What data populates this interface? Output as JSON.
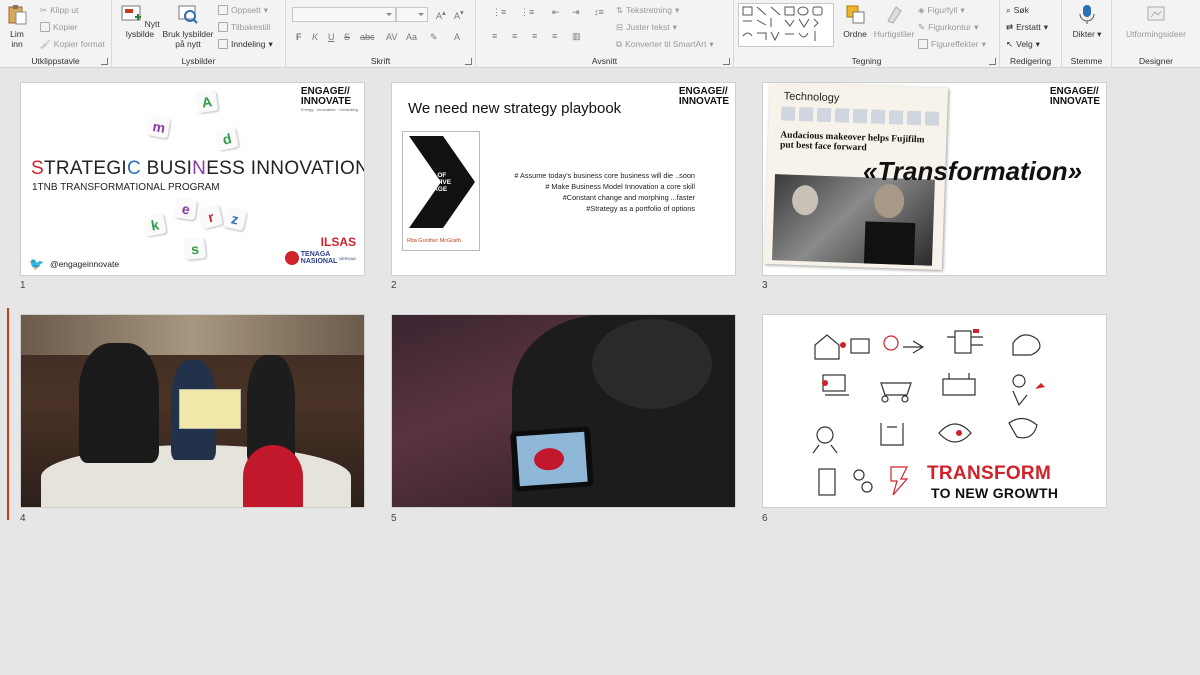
{
  "ribbon": {
    "clipboard": {
      "label": "Utklippstavle",
      "paste": "Lim\ninn",
      "cut": "Klipp ut",
      "copy": "Kopier",
      "format_painter": "Kopier format"
    },
    "slides": {
      "label": "Lysbilder",
      "new_slide": "Nytt\nlysbilde",
      "reuse": "Bruk lysbilder\npå nytt",
      "layout": "Oppsett",
      "reset": "Tilbakestill",
      "section": "Inndeling"
    },
    "font": {
      "label": "Skrift",
      "bold": "F",
      "italic": "K",
      "underline": "U",
      "strike": "S",
      "spacing": "AV",
      "case": "Aa"
    },
    "paragraph": {
      "label": "Avsnitt",
      "text_direction": "Tekstretning",
      "align_text": "Juster tekst",
      "smartart": "Konverter til SmartArt"
    },
    "drawing": {
      "label": "Tegning",
      "arrange": "Ordne",
      "quick_styles": "Hurtigstiler",
      "fill": "Figurfyll",
      "outline": "Figurkontur",
      "effects": "Figureffekter"
    },
    "editing": {
      "label": "Redigering",
      "find": "Søk",
      "replace": "Erstatt",
      "select": "Velg"
    },
    "voice": {
      "label": "Stemme",
      "dictate": "Dikter"
    },
    "designer": {
      "label": "Designer",
      "ideas": "Utformingsideer"
    }
  },
  "slides": [
    {
      "num": "1",
      "title_prefix": "S",
      "title_a": "TRATEGI",
      "title_b": "C",
      "title_c": " BUSI",
      "title_d": "N",
      "title_e": "ESS INNOVATION",
      "subtitle": "1TNB TRANSFORMATIONAL PROGRAM",
      "twitter": "@engageinnovate",
      "logo": "ENGAGE//\nINNOVATE",
      "logo_tag": "Energy · Innovation · Consulting",
      "tiles": [
        "A",
        "m",
        "d",
        "k",
        "e",
        "r",
        "z",
        "s"
      ],
      "ilsas": "ILSAS",
      "tenaga": "TENAGA\nNASIONAL",
      "berhad": "BERHAD"
    },
    {
      "num": "2",
      "title": "We need new strategy playbook",
      "logo": "ENGAGE//\nINNOVATE",
      "book_title": "THE END OF\nCOMPETITIVE\nADVANTAGE",
      "book_author": "Rita Gunther McGrath",
      "bullets": [
        "# Assume today's business core business will die ..soon",
        "# Make Business Model Innovation a core skill",
        "#Constant change and morphing ...faster",
        "#Strategy as a portfolio of options"
      ]
    },
    {
      "num": "3",
      "logo": "ENGAGE//\nINNOVATE",
      "news_section": "Technology",
      "headline": "Audacious makeover helps Fujifilm put best face forward",
      "overlay": "«Transformation»"
    },
    {
      "num": "4"
    },
    {
      "num": "5"
    },
    {
      "num": "6",
      "tagline1": "TRANSFORM",
      "tagline2": "TO NEW GROWTH"
    }
  ],
  "colors": {
    "accent": "#c43e1c",
    "letter_red": "#d0222b",
    "letter_blue": "#2d6fb7",
    "letter_purple": "#8a3aa6",
    "twitter": "#1da1f2"
  }
}
